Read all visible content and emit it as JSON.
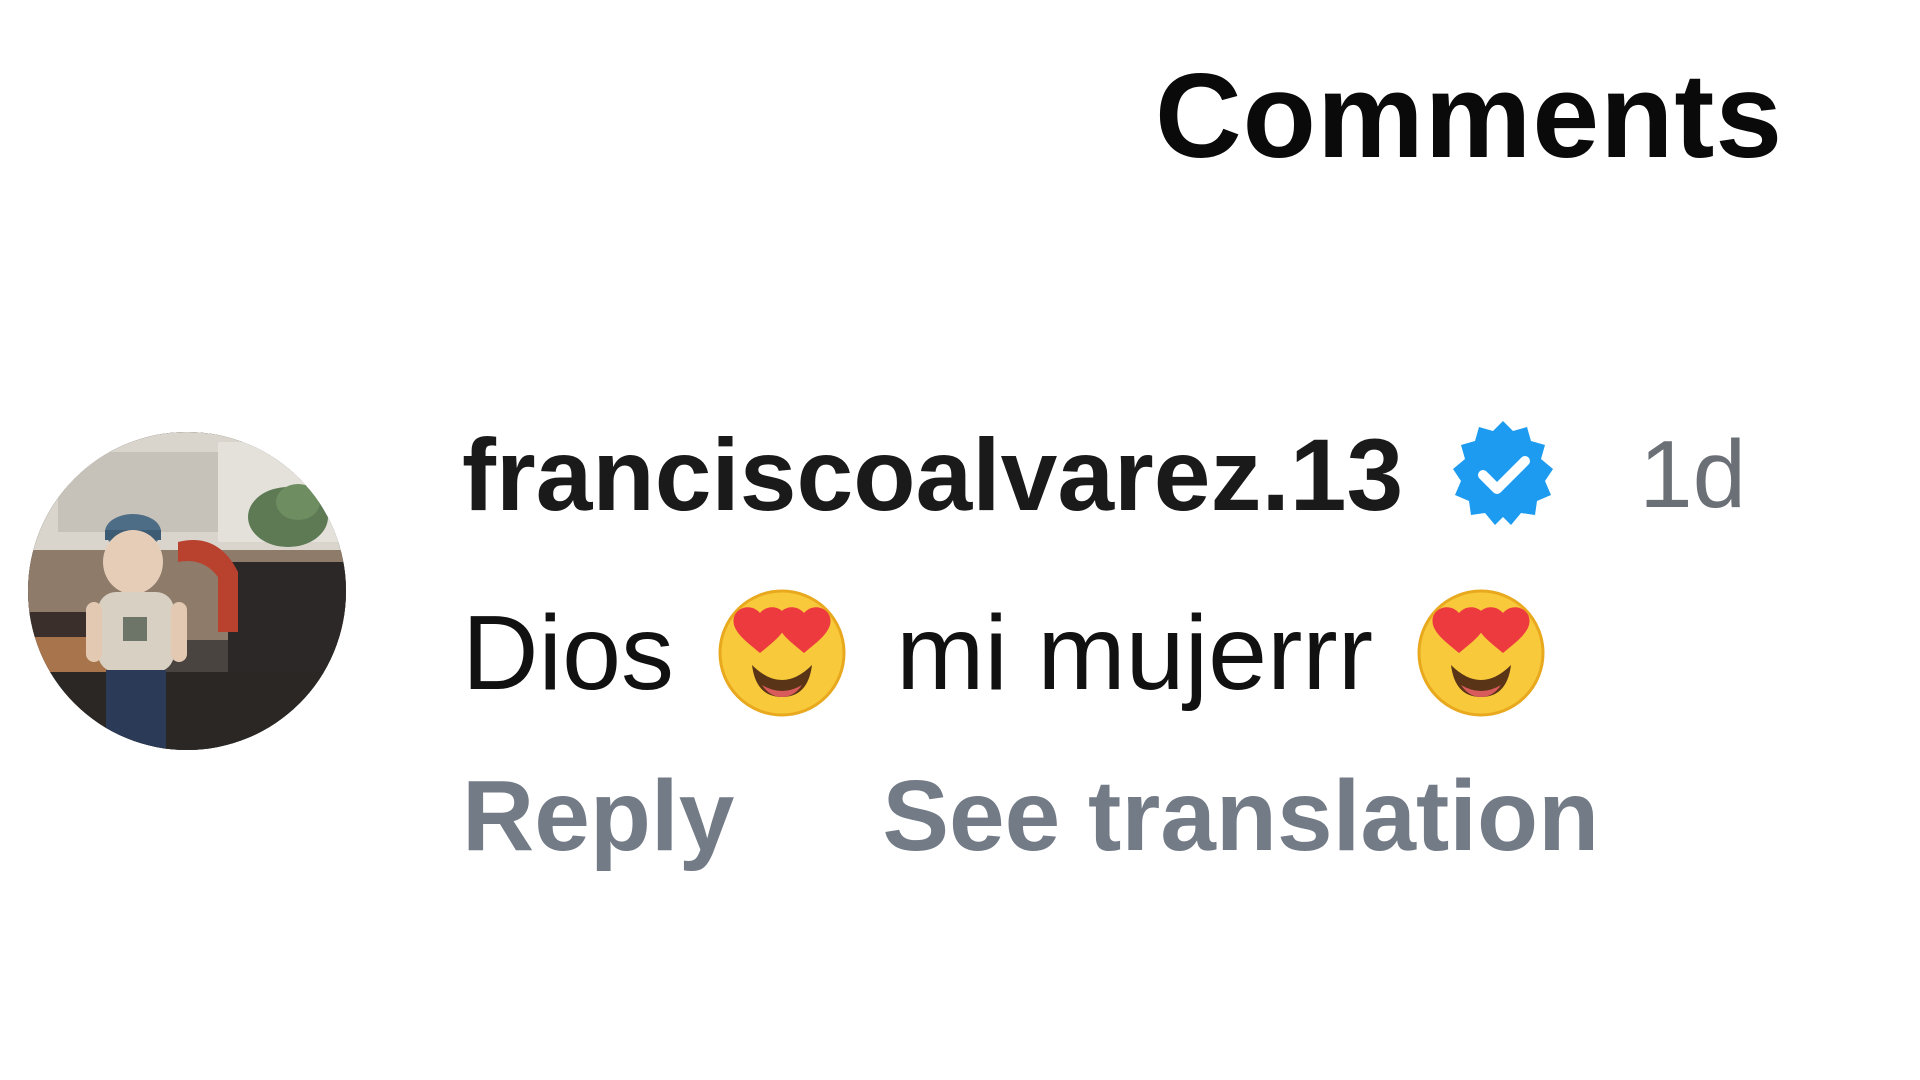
{
  "header": {
    "title": "Comments"
  },
  "comment": {
    "avatar_icon": "profile-photo",
    "username": "franciscoalvarez.13",
    "verified_icon": "verified-badge-icon",
    "verified_color": "#1d9bf0",
    "timestamp": "1d",
    "text_parts": [
      "Dios",
      "mi mujerrr"
    ],
    "emoji": "heart-eyes-emoji",
    "actions": {
      "reply": "Reply",
      "see_translation": "See translation"
    }
  }
}
